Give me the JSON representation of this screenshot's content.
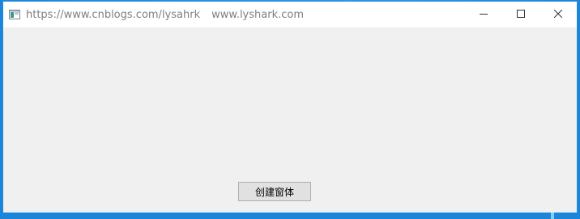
{
  "window": {
    "title_part1": "https://www.cnblogs.com/lysahrk",
    "title_part2": "www.lyshark.com",
    "controls": {
      "minimize_icon": "minimize-icon",
      "maximize_icon": "maximize-icon",
      "close_icon": "close-icon"
    }
  },
  "client": {
    "create_button_label": "创建窗体"
  },
  "colors": {
    "desktop": "#1b8fe0",
    "window_bg": "#f0f0f0",
    "titlebar_bg": "#ffffff",
    "button_bg": "#e1e1e1"
  }
}
